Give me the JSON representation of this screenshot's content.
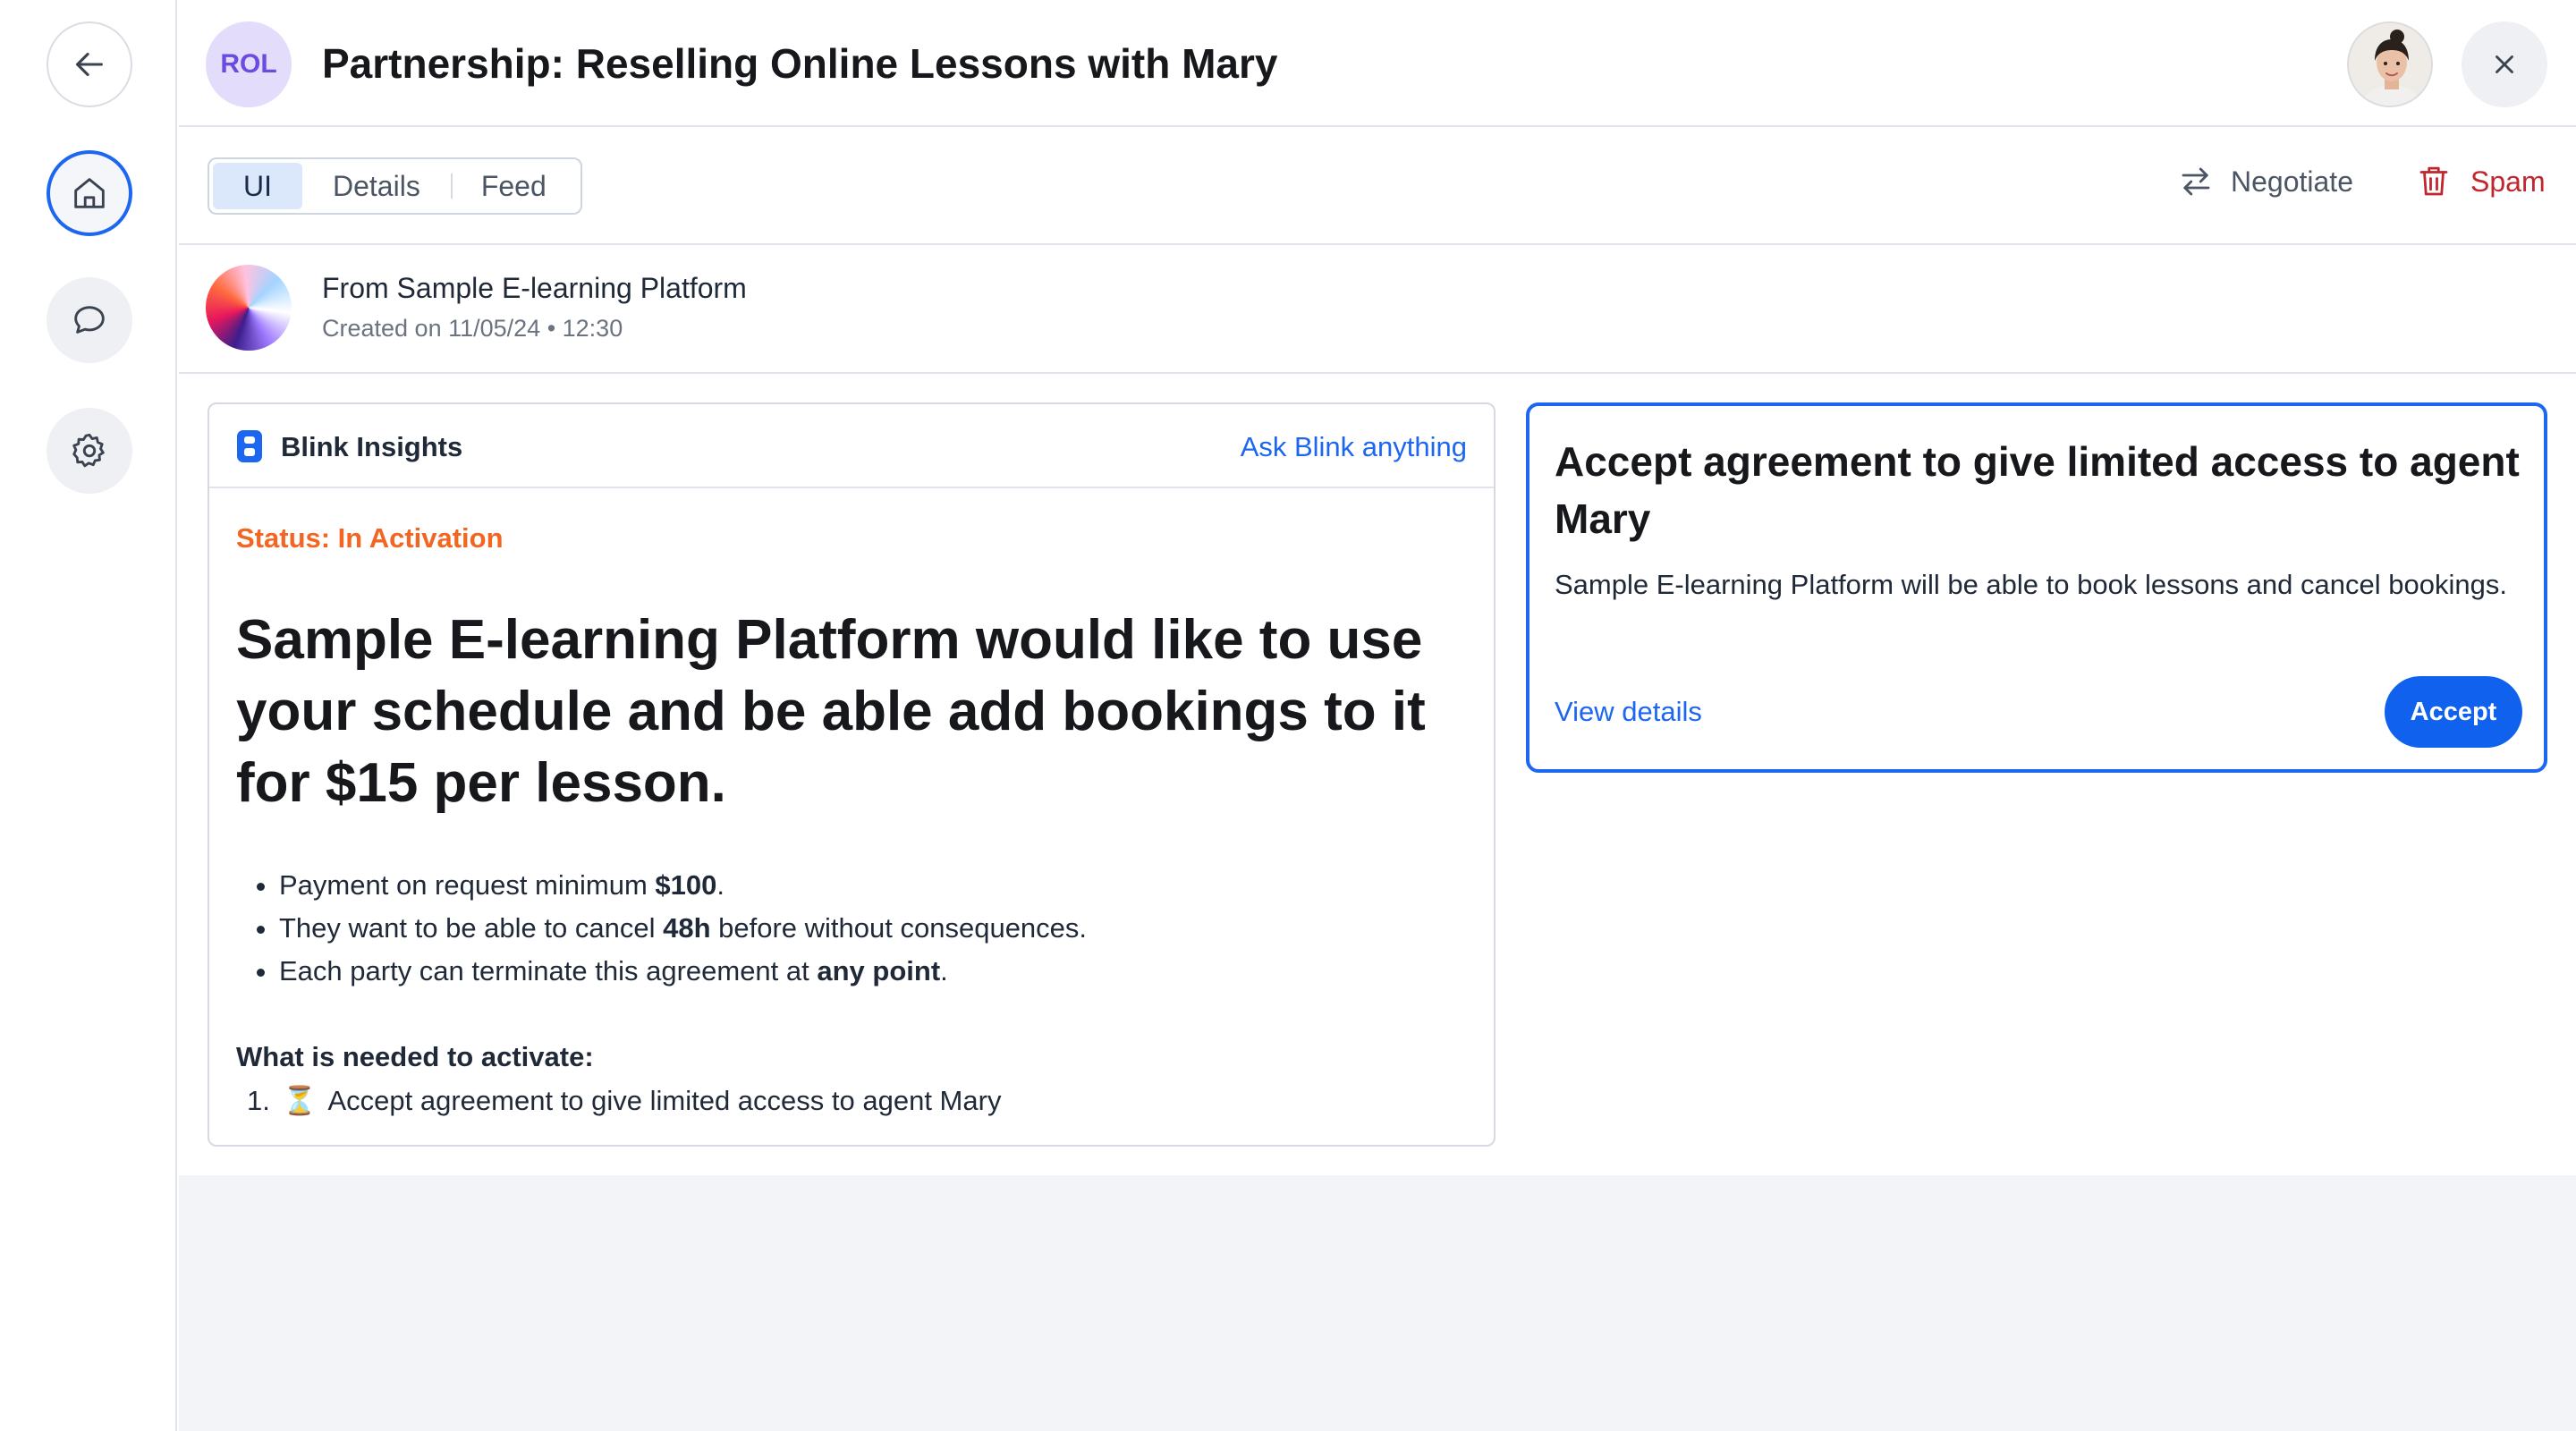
{
  "window": {
    "title": "Partnership: Reselling Online Lessons with Mary",
    "badge": "ROL"
  },
  "rail": {
    "items": [
      {
        "name": "back",
        "icon": "arrow-left-icon"
      },
      {
        "name": "home",
        "icon": "home-icon",
        "active": true
      },
      {
        "name": "chat",
        "icon": "chat-icon"
      },
      {
        "name": "settings",
        "icon": "gear-icon"
      }
    ]
  },
  "toolbar": {
    "tabs": [
      {
        "label": "UI",
        "active": true
      },
      {
        "label": "Details",
        "active": false
      },
      {
        "label": "Feed",
        "active": false
      }
    ],
    "negotiate_label": "Negotiate",
    "spam_label": "Spam"
  },
  "sender": {
    "from": "From Sample E-learning Platform",
    "meta": "Created on 11/05/24 • 12:30"
  },
  "insights": {
    "title": "Blink Insights",
    "ask_link": "Ask Blink anything",
    "status": "Status: In Activation",
    "headline": "Sample E-learning Platform would like to use your schedule and be able add bookings to it for $15 per lesson.",
    "bullets": [
      {
        "pre": "Payment on request minimum ",
        "bold": "$100",
        "post": "."
      },
      {
        "pre": "They want to be able to cancel ",
        "bold": "48h",
        "post": " before without consequences."
      },
      {
        "pre": "Each party can terminate this agreement at ",
        "bold": "any point",
        "post": "."
      }
    ],
    "needed_heading": "What is needed to activate:",
    "steps": [
      {
        "num": "1.",
        "icon": "⏳",
        "text": "Accept agreement to give limited access to agent Mary"
      }
    ]
  },
  "action_card": {
    "title": "Accept agreement to give limited access to agent Mary",
    "description": "Sample E-learning Platform will be able to book lessons and cancel bookings.",
    "link": "View details",
    "button": "Accept"
  },
  "colors": {
    "accent": "#1d66f0",
    "status": "#f26522",
    "danger": "#c0262d",
    "badge_bg": "#e3dcfb",
    "badge_fg": "#6b4be0"
  }
}
